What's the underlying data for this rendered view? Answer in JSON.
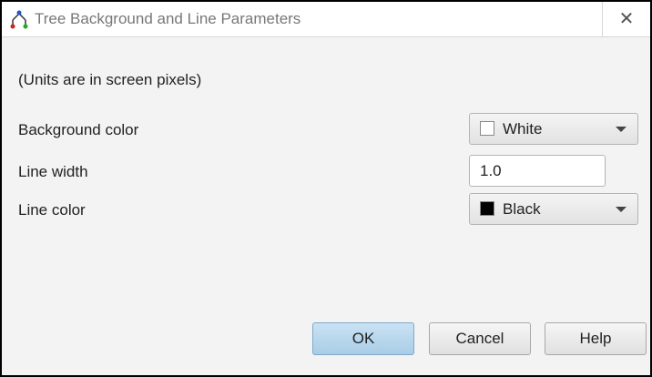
{
  "window": {
    "title": "Tree Background and Line Parameters",
    "app_icon": "tree-icon",
    "close_label": "✕"
  },
  "form": {
    "units_note": "(Units are in screen pixels)",
    "background_color": {
      "label": "Background color",
      "value": "White",
      "swatch": "#ffffff"
    },
    "line_width": {
      "label": "Line width",
      "value": "1.0"
    },
    "line_color": {
      "label": "Line color",
      "value": "Black",
      "swatch": "#000000"
    }
  },
  "buttons": {
    "ok": "OK",
    "cancel": "Cancel",
    "help": "Help"
  },
  "colors": {
    "default_button": "#b3d4ec"
  }
}
